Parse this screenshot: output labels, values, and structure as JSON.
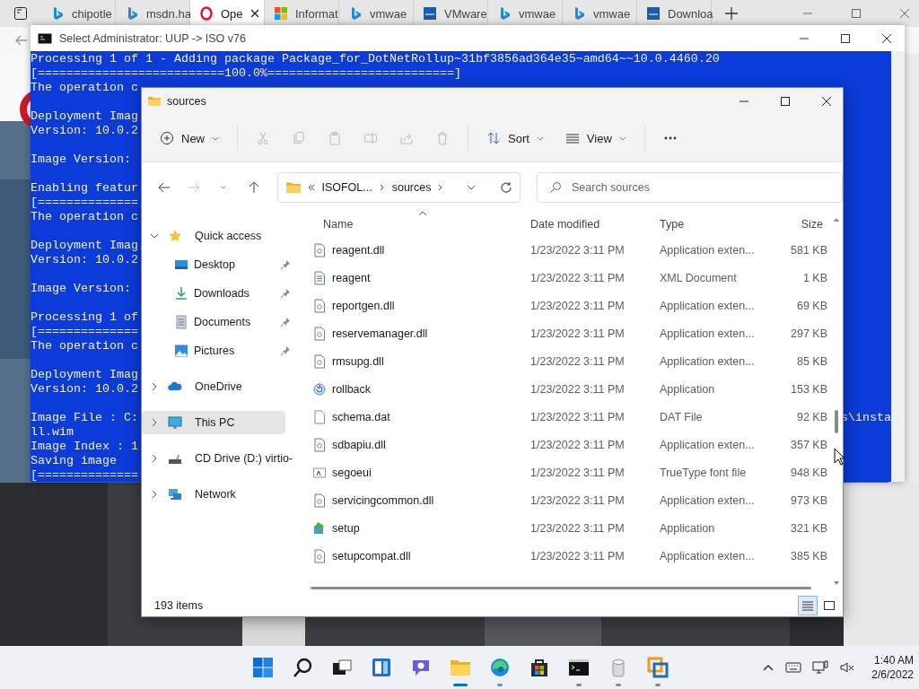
{
  "browser": {
    "tabs": [
      {
        "label": "chipotle",
        "kind": "bing",
        "selected": false
      },
      {
        "label": "msdn.ha",
        "kind": "bing",
        "selected": false
      },
      {
        "label": "Ope",
        "kind": "opera",
        "selected": true
      },
      {
        "label": "Informat",
        "kind": "ms",
        "selected": false
      },
      {
        "label": "vmwae",
        "kind": "bing",
        "selected": false
      },
      {
        "label": "VMware",
        "kind": "vmw",
        "selected": false
      },
      {
        "label": "vmwae",
        "kind": "bing",
        "selected": false
      },
      {
        "label": "vmwae",
        "kind": "bing",
        "selected": false
      },
      {
        "label": "Downloa",
        "kind": "vmw",
        "selected": false
      }
    ]
  },
  "console": {
    "title": "Select Administrator:  UUP -> ISO v76",
    "blocks": [
      [
        {
          "text": "Processing 1 of 1 - Adding package Package_for_DotNetRollup~31bf3856ad364e35~amd64~~10.0.4460.20"
        },
        {
          "text": "[==========================100.0%==========================]"
        },
        {
          "text": "The operation c"
        }
      ],
      [
        {
          "text": "Deployment Imag"
        },
        {
          "text": "Version: 10.0.2"
        }
      ],
      [
        {
          "text": "Image Version:"
        }
      ],
      [
        {
          "text": "Enabling featur"
        },
        {
          "text": "[=============="
        },
        {
          "text": "The operation c"
        }
      ],
      [
        {
          "text": "Deployment Imag"
        },
        {
          "text": "Version: 10.0.2"
        }
      ],
      [
        {
          "text": "Image Version:"
        }
      ],
      [
        {
          "text": "Processing 1 of"
        },
        {
          "text": "[=============="
        },
        {
          "text": "The operation c"
        }
      ],
      [
        {
          "text": "Deployment Imag"
        },
        {
          "text": "Version: 10.0.2"
        }
      ],
      [
        {
          "text": "Image File : C:",
          "right": "s\\insta"
        },
        {
          "text": "ll.wim"
        },
        {
          "text": "Image Index : 1"
        },
        {
          "text": "Saving image"
        },
        {
          "text": "[=============="
        }
      ]
    ]
  },
  "explorer": {
    "title": "sources",
    "toolbar": [
      {
        "kind": "new",
        "label": "New",
        "disabled": false
      },
      {
        "kind": "cut",
        "disabled": true
      },
      {
        "kind": "copy",
        "disabled": true
      },
      {
        "kind": "paste",
        "disabled": true
      },
      {
        "kind": "rename",
        "disabled": true
      },
      {
        "kind": "share",
        "disabled": true
      },
      {
        "kind": "delete",
        "disabled": true
      },
      {
        "kind": "sort",
        "label": "Sort",
        "disabled": false
      },
      {
        "kind": "view",
        "label": "View",
        "disabled": false
      },
      {
        "kind": "more",
        "disabled": false
      }
    ],
    "navigation": [
      {
        "kind": "back",
        "disabled": false
      },
      {
        "kind": "forward",
        "disabled": true
      },
      {
        "kind": "recent",
        "disabled": false
      },
      {
        "kind": "up",
        "disabled": false
      }
    ],
    "address": {
      "crumbs": [
        "ISOFOL...",
        "sources"
      ]
    },
    "search": {
      "placeholder": "Search sources"
    },
    "nav": [
      {
        "label": "Quick access",
        "kind": "star",
        "expanded": true,
        "selected": false,
        "children": [
          {
            "label": "Desktop",
            "kind": "desktop",
            "pinned": true,
            "selected": false
          },
          {
            "label": "Downloads",
            "kind": "download",
            "pinned": true,
            "selected": false
          },
          {
            "label": "Documents",
            "kind": "documents",
            "pinned": true,
            "selected": false
          },
          {
            "label": "Pictures",
            "kind": "pictures",
            "pinned": true,
            "selected": false
          }
        ]
      },
      {
        "label": "OneDrive",
        "kind": "cloud",
        "expanded": false,
        "selected": false
      },
      {
        "label": "This PC",
        "kind": "pc",
        "expanded": false,
        "selected": true
      },
      {
        "label": "CD Drive (D:) virtio-",
        "kind": "drive",
        "expanded": false,
        "selected": false
      },
      {
        "label": "Network",
        "kind": "network",
        "expanded": false,
        "selected": false
      }
    ],
    "columns": [
      {
        "label": "Name",
        "sorted": true
      },
      {
        "label": "Date modified",
        "sorted": false
      },
      {
        "label": "Type",
        "sorted": false
      },
      {
        "label": "Size",
        "sorted": false
      }
    ],
    "rows": [
      {
        "kind": "dll",
        "name": "reagent.dll",
        "date": "1/23/2022 3:11 PM",
        "type": "Application exten...",
        "size": "581 KB"
      },
      {
        "kind": "xml",
        "name": "reagent",
        "date": "1/23/2022 3:11 PM",
        "type": "XML Document",
        "size": "1 KB"
      },
      {
        "kind": "dll",
        "name": "reportgen.dll",
        "date": "1/23/2022 3:11 PM",
        "type": "Application exten...",
        "size": "69 KB"
      },
      {
        "kind": "dll",
        "name": "reservemanager.dll",
        "date": "1/23/2022 3:11 PM",
        "type": "Application exten...",
        "size": "297 KB"
      },
      {
        "kind": "dll",
        "name": "rmsupg.dll",
        "date": "1/23/2022 3:11 PM",
        "type": "Application exten...",
        "size": "85 KB"
      },
      {
        "kind": "rollback",
        "name": "rollback",
        "date": "1/23/2022 3:11 PM",
        "type": "Application",
        "size": "153 KB"
      },
      {
        "kind": "dat",
        "name": "schema.dat",
        "date": "1/23/2022 3:11 PM",
        "type": "DAT File",
        "size": "92 KB"
      },
      {
        "kind": "dll",
        "name": "sdbapiu.dll",
        "date": "1/23/2022 3:11 PM",
        "type": "Application exten...",
        "size": "357 KB"
      },
      {
        "kind": "font",
        "name": "segoeui",
        "date": "1/23/2022 3:11 PM",
        "type": "TrueType font file",
        "size": "948 KB"
      },
      {
        "kind": "dll",
        "name": "servicingcommon.dll",
        "date": "1/23/2022 3:11 PM",
        "type": "Application exten...",
        "size": "973 KB"
      },
      {
        "kind": "setup",
        "name": "setup",
        "date": "1/23/2022 3:11 PM",
        "type": "Application",
        "size": "321 KB"
      },
      {
        "kind": "dll",
        "name": "setupcompat.dll",
        "date": "1/23/2022 3:11 PM",
        "type": "Application exten...",
        "size": "385 KB"
      }
    ],
    "status": "193 items",
    "views": [
      {
        "kind": "details",
        "selected": true
      },
      {
        "kind": "tiles",
        "selected": false
      }
    ]
  },
  "taskbar": {
    "apps": [
      {
        "kind": "start",
        "running": false,
        "active": false
      },
      {
        "kind": "search",
        "running": false,
        "active": false
      },
      {
        "kind": "taskview",
        "running": false,
        "active": false
      },
      {
        "kind": "widgets",
        "running": false,
        "active": false
      },
      {
        "kind": "chat",
        "running": false,
        "active": false
      },
      {
        "kind": "explorer",
        "running": true,
        "active": true
      },
      {
        "kind": "edge",
        "running": true,
        "active": false
      },
      {
        "kind": "store",
        "running": false,
        "active": false
      },
      {
        "kind": "terminal",
        "running": true,
        "active": false
      },
      {
        "kind": "disc",
        "running": true,
        "active": false
      },
      {
        "kind": "vm",
        "running": true,
        "active": false
      }
    ],
    "clock": {
      "time": "1:40 AM",
      "date": "2/6/2022"
    }
  }
}
